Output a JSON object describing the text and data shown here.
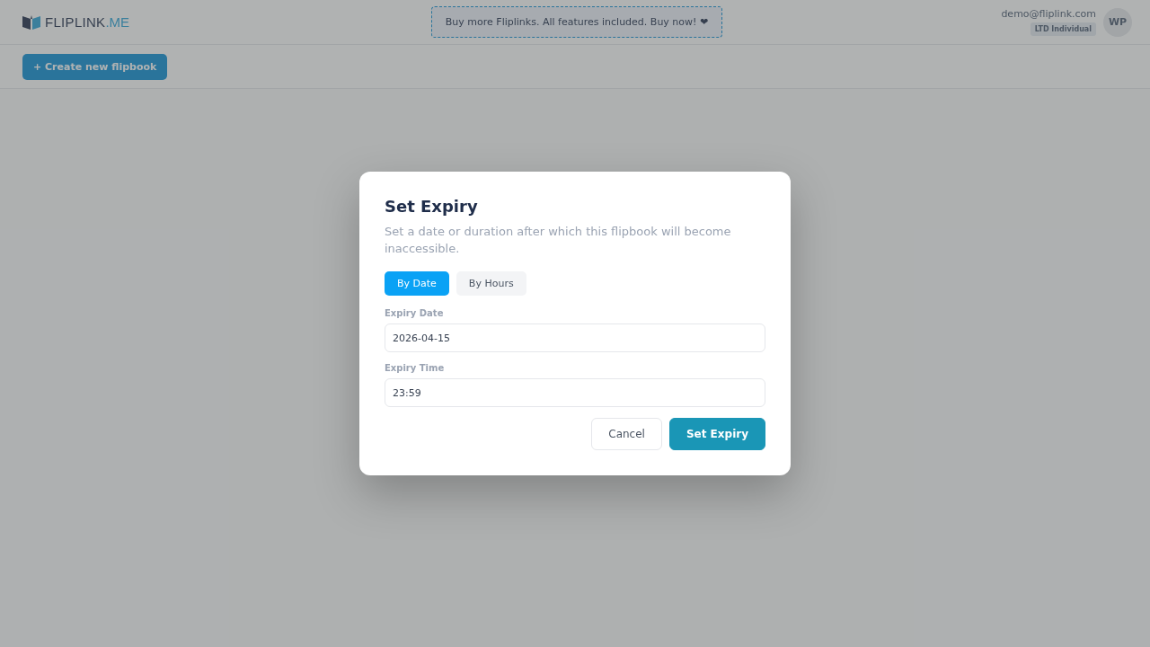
{
  "header": {
    "logo": {
      "name": "FLIPLINK",
      "suffix": ".ME"
    },
    "promo": "Buy more Fliplinks. All features included. Buy now! ❤",
    "user": {
      "email": "demo@fliplink.com",
      "plan": "LTD Individual",
      "initials": "WP"
    }
  },
  "toolbar": {
    "create_button": "+ Create new flipbook"
  },
  "dialog": {
    "title": "Set Expiry",
    "description": "Set a date or duration after which this flipbook will become inaccessible.",
    "tabs": [
      {
        "label": "By Date",
        "selected": true
      },
      {
        "label": "By Hours",
        "selected": false
      }
    ],
    "fields": [
      {
        "label": "Expiry Date",
        "value": "2026-04-15"
      },
      {
        "label": "Expiry Time",
        "value": "23:59"
      }
    ],
    "buttons": [
      {
        "label": "Cancel",
        "kind": "secondary"
      },
      {
        "label": "Set Expiry",
        "kind": "primary"
      }
    ]
  }
}
